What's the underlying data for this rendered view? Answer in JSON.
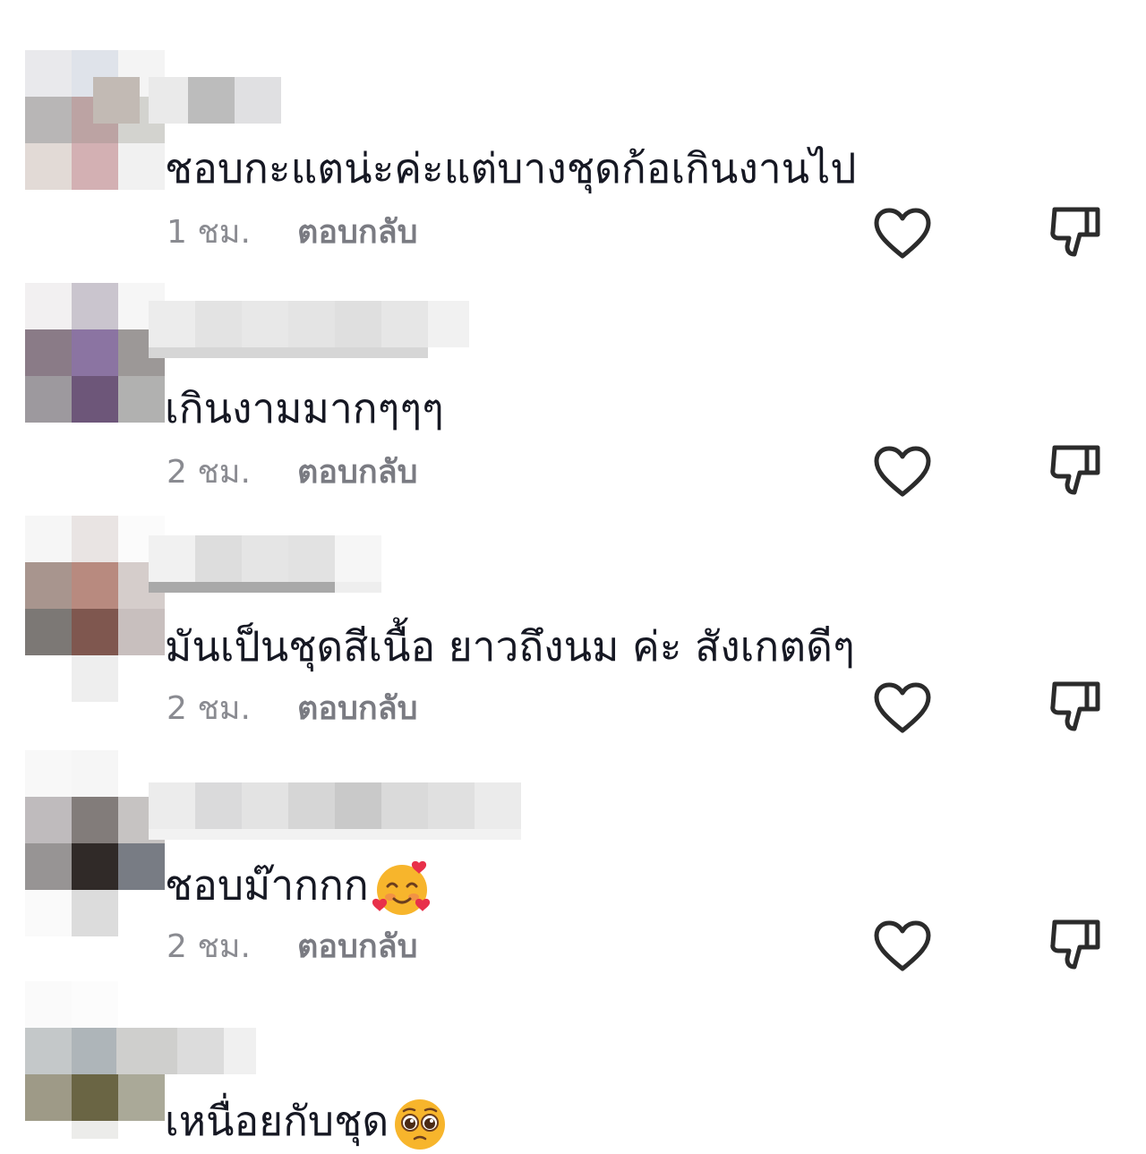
{
  "comments": [
    {
      "text": "ชอบกะแตน่ะค่ะแต่บางชุดก้อเกินงานไป",
      "time": "1 ชม.",
      "reply": "ตอบกลับ",
      "emoji": ""
    },
    {
      "text": "เกินงามมากๆๆๆ",
      "time": "2 ชม.",
      "reply": "ตอบกลับ",
      "emoji": ""
    },
    {
      "text": "มันเป็นชุดสีเนื้อ ยาวถึงนม ค่ะ สังเกตดีๆ",
      "time": "2 ชม.",
      "reply": "ตอบกลับ",
      "emoji": ""
    },
    {
      "text": "ชอบม๊ากกก",
      "time": "2 ชม.",
      "reply": "ตอบกลับ",
      "emoji": "smiling-face-with-hearts-icon"
    },
    {
      "text": "เหนื่อยกับชุด",
      "time": "",
      "reply": "",
      "emoji": "pleading-face-icon"
    }
  ],
  "icons": {
    "like": "heart-icon",
    "dislike": "thumbs-down-icon",
    "avatar": "pixelated-avatar"
  },
  "colors": {
    "text": "#161823",
    "meta": "#8a8b91",
    "icon": "#2b2b2b"
  }
}
